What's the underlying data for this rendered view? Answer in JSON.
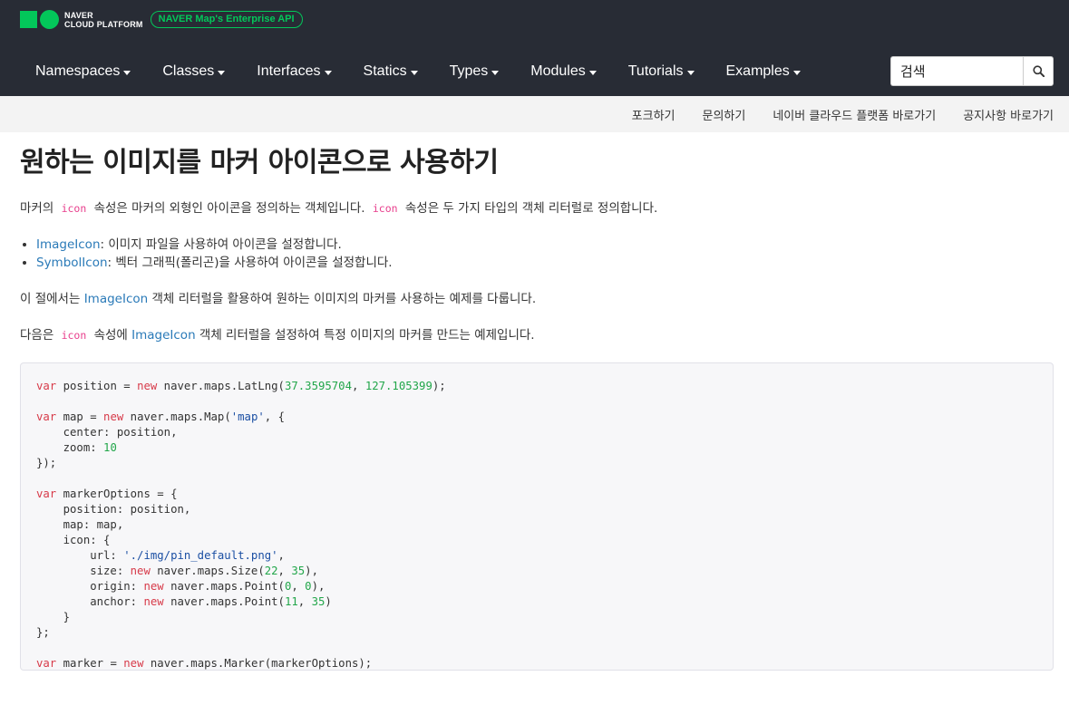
{
  "header": {
    "brand_line1": "NAVER",
    "brand_line2": "CLOUD PLATFORM",
    "badge": "NAVER Map's Enterprise API",
    "nav": [
      "Namespaces",
      "Classes",
      "Interfaces",
      "Statics",
      "Types",
      "Modules",
      "Tutorials",
      "Examples"
    ],
    "search_placeholder": "검색"
  },
  "subnav": [
    "포크하기",
    "문의하기",
    "네이버 클라우드 플랫폼 바로가기",
    "공지사항 바로가기"
  ],
  "main": {
    "title": "원하는 이미지를 마커 아이콘으로 사용하기",
    "p1_a": "마커의",
    "p1_code1": "icon",
    "p1_b": "속성은 마커의 외형인 아이콘을 정의하는 객체입니다.",
    "p1_code2": "icon",
    "p1_c": "속성은 두 가지 타입의 객체 리터럴로 정의합니다.",
    "list": [
      {
        "link": "ImageIcon",
        "text": ": 이미지 파일을 사용하여 아이콘을 설정합니다."
      },
      {
        "link": "SymbolIcon",
        "text": ": 벡터 그래픽(폴리곤)을 사용하여 아이콘을 설정합니다."
      }
    ],
    "p2_a": "이 절에서는",
    "p2_link": "ImageIcon",
    "p2_b": "객체 리터럴을 활용하여 원하는 이미지의 마커를 사용하는 예제를 다룹니다.",
    "p3_a": "다음은",
    "p3_code": "icon",
    "p3_b": "속성에",
    "p3_link": "ImageIcon",
    "p3_c": "객체 리터럴을 설정하여 특정 이미지의 마커를 만드는 예제입니다."
  },
  "code_lines": [
    [
      [
        "kw",
        "var"
      ],
      [
        "t",
        " position = "
      ],
      [
        "kw",
        "new"
      ],
      [
        "t",
        " naver.maps.LatLng("
      ],
      [
        "num",
        "37.3595704"
      ],
      [
        "t",
        ", "
      ],
      [
        "num",
        "127.105399"
      ],
      [
        "t",
        ");"
      ]
    ],
    [],
    [
      [
        "kw",
        "var"
      ],
      [
        "t",
        " map = "
      ],
      [
        "kw",
        "new"
      ],
      [
        "t",
        " naver.maps.Map("
      ],
      [
        "str",
        "'map'"
      ],
      [
        "t",
        ", {"
      ]
    ],
    [
      [
        "t",
        "    center: position,"
      ]
    ],
    [
      [
        "t",
        "    zoom: "
      ],
      [
        "num",
        "10"
      ]
    ],
    [
      [
        "t",
        "});"
      ]
    ],
    [],
    [
      [
        "kw",
        "var"
      ],
      [
        "t",
        " markerOptions = {"
      ]
    ],
    [
      [
        "t",
        "    position: position,"
      ]
    ],
    [
      [
        "t",
        "    map: map,"
      ]
    ],
    [
      [
        "t",
        "    icon: {"
      ]
    ],
    [
      [
        "t",
        "        url: "
      ],
      [
        "str",
        "'./img/pin_default.png'"
      ],
      [
        "t",
        ","
      ]
    ],
    [
      [
        "t",
        "        size: "
      ],
      [
        "kw",
        "new"
      ],
      [
        "t",
        " naver.maps.Size("
      ],
      [
        "num",
        "22"
      ],
      [
        "t",
        ", "
      ],
      [
        "num",
        "35"
      ],
      [
        "t",
        "),"
      ]
    ],
    [
      [
        "t",
        "        origin: "
      ],
      [
        "kw",
        "new"
      ],
      [
        "t",
        " naver.maps.Point("
      ],
      [
        "num",
        "0"
      ],
      [
        "t",
        ", "
      ],
      [
        "num",
        "0"
      ],
      [
        "t",
        "),"
      ]
    ],
    [
      [
        "t",
        "        anchor: "
      ],
      [
        "kw",
        "new"
      ],
      [
        "t",
        " naver.maps.Point("
      ],
      [
        "num",
        "11"
      ],
      [
        "t",
        ", "
      ],
      [
        "num",
        "35"
      ],
      [
        "t",
        ")"
      ]
    ],
    [
      [
        "t",
        "    }"
      ]
    ],
    [
      [
        "t",
        "};"
      ]
    ],
    [],
    [
      [
        "kw",
        "var"
      ],
      [
        "t",
        " marker = "
      ],
      [
        "kw",
        "new"
      ],
      [
        "t",
        " naver.maps.Marker(markerOptions);"
      ]
    ]
  ]
}
